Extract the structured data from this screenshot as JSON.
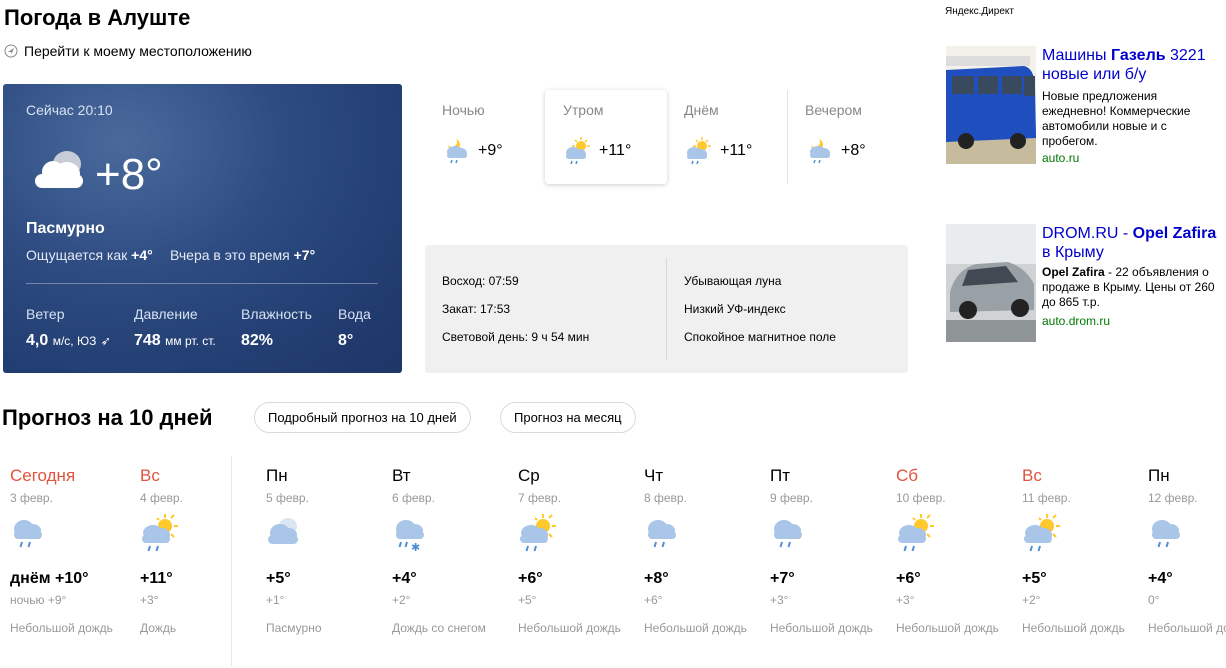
{
  "header": {
    "title": "Погода в Алуште",
    "location_link": "Перейти к моему местоположению"
  },
  "now": {
    "time": "Сейчас 20:10",
    "temp": "+8°",
    "condition": "Пасмурно",
    "feels_label": "Ощущается как",
    "feels_value": "+4°",
    "yesterday_label": "Вчера в это время",
    "yesterday_value": "+7°",
    "icon": "cloudy-icon",
    "stats": {
      "wind_label": "Ветер",
      "wind_value": "4,0",
      "wind_unit": "м/с, ЮЗ",
      "pressure_label": "Давление",
      "pressure_value": "748",
      "pressure_unit": "мм рт. ст.",
      "humidity_label": "Влажность",
      "humidity_value": "82%",
      "water_label": "Вода",
      "water_value": "8°"
    }
  },
  "day_parts": [
    {
      "name": "Ночью",
      "temp": "+9°",
      "icon": "night-rain-icon"
    },
    {
      "name": "Утром",
      "temp": "+11°",
      "icon": "sun-cloud-rain-icon"
    },
    {
      "name": "Днём",
      "temp": "+11°",
      "icon": "sun-cloud-rain-icon"
    },
    {
      "name": "Вечером",
      "temp": "+8°",
      "icon": "night-rain-icon"
    }
  ],
  "sun_info": {
    "sunrise": "Восход: 07:59",
    "sunset": "Закат: 17:53",
    "daylight": "Световой день: 9 ч 54 мин",
    "moon": "Убывающая луна",
    "uv": "Низкий УФ-индекс",
    "magnetic": "Спокойное магнитное поле"
  },
  "ads": {
    "label": "Яндекс.Директ",
    "items": [
      {
        "title_pre": "Машины ",
        "title_bold": "Газель",
        "title_post": " 3221",
        "title_line2": "новые или б/у",
        "desc": [
          "Новые предложения",
          "ежедневно! Коммерческие",
          "автомобили новые и с",
          "пробегом."
        ],
        "url": "auto.ru"
      },
      {
        "title_pre": "DROM.RU - ",
        "title_bold": "Opel Zafira",
        "title_post": "",
        "title_line2": "в Крыму",
        "desc_bold": "Opel Zafira",
        "desc": [
          " - 22 объявления о",
          "продаже в Крыму. Цены от 260",
          "до 865 т.р."
        ],
        "url": "auto.drom.ru"
      }
    ]
  },
  "forecast": {
    "title": "Прогноз на 10 дней",
    "btn_detailed": "Подробный прогноз на 10 дней",
    "btn_month": "Прогноз на месяц",
    "days": [
      {
        "name": "Сегодня",
        "date": "3 февр.",
        "temp": "днём +10°",
        "night": "ночью +9°",
        "cond": "Небольшой дождь",
        "red": true,
        "icon": "cloud-rain-icon"
      },
      {
        "name": "Вс",
        "date": "4 февр.",
        "temp": "+11°",
        "night": "+3°",
        "cond": "Дождь",
        "red": true,
        "icon": "sun-cloud-rain-icon"
      },
      {
        "name": "Пн",
        "date": "5 февр.",
        "temp": "+5°",
        "night": "+1°",
        "cond": "Пасмурно",
        "red": false,
        "icon": "overcast-icon"
      },
      {
        "name": "Вт",
        "date": "6 февр.",
        "temp": "+4°",
        "night": "+2°",
        "cond": "Дождь со снегом",
        "red": false,
        "icon": "rain-snow-icon"
      },
      {
        "name": "Ср",
        "date": "7 февр.",
        "temp": "+6°",
        "night": "+5°",
        "cond": "Небольшой дождь",
        "red": false,
        "icon": "sun-cloud-rain-icon"
      },
      {
        "name": "Чт",
        "date": "8 февр.",
        "temp": "+8°",
        "night": "+6°",
        "cond": "Небольшой дождь",
        "red": false,
        "icon": "cloud-rain-icon"
      },
      {
        "name": "Пт",
        "date": "9 февр.",
        "temp": "+7°",
        "night": "+3°",
        "cond": "Небольшой дождь",
        "red": false,
        "icon": "cloud-rain-icon"
      },
      {
        "name": "Сб",
        "date": "10 февр.",
        "temp": "+6°",
        "night": "+3°",
        "cond": "Небольшой дождь",
        "red": true,
        "icon": "sun-cloud-rain-icon"
      },
      {
        "name": "Вс",
        "date": "11 февр.",
        "temp": "+5°",
        "night": "+2°",
        "cond": "Небольшой дождь",
        "red": true,
        "icon": "sun-cloud-rain-icon"
      },
      {
        "name": "Пн",
        "date": "12 февр.",
        "temp": "+4°",
        "night": "0°",
        "cond": "Небольшой дождь",
        "red": false,
        "icon": "cloud-rain-icon"
      }
    ]
  },
  "colors": {
    "accent_red": "#e0533d",
    "card_blue": "#2e4c82",
    "link_blue": "#0000cc",
    "url_green": "#007700"
  }
}
